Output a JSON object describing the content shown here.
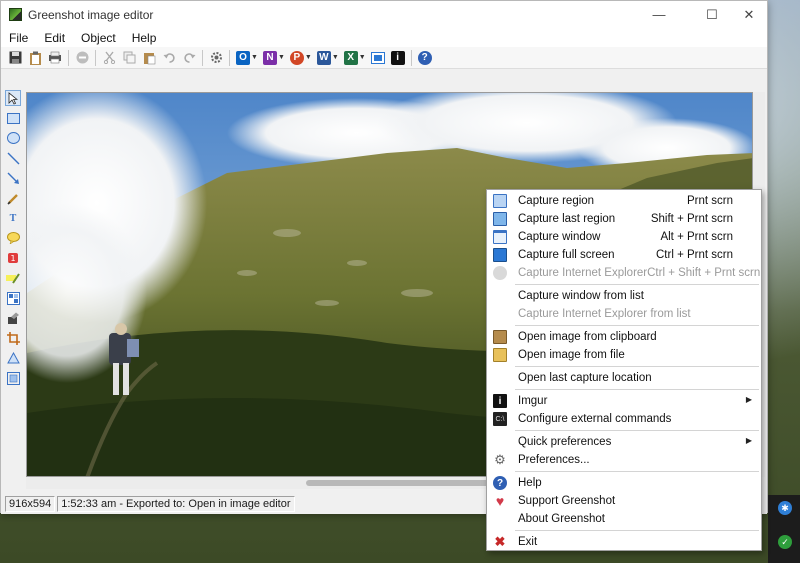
{
  "window": {
    "title": "Greenshot image editor",
    "minimize_glyph": "—",
    "maximize_glyph": "☐",
    "close_glyph": "✕"
  },
  "menubar": {
    "items": [
      {
        "label": "File"
      },
      {
        "label": "Edit"
      },
      {
        "label": "Object"
      },
      {
        "label": "Help"
      }
    ]
  },
  "toolbar": {
    "buttons": [
      "save-icon",
      "clipboard-icon",
      "print-icon",
      "delete-icon",
      "cut-icon",
      "copy-icon",
      "paste-icon",
      "undo-icon",
      "redo-icon",
      "settings-icon",
      "outlook-icon",
      "onenote-icon",
      "powerpoint-icon",
      "word-icon",
      "excel-icon",
      "resize-icon",
      "imgur-icon",
      "help-icon"
    ]
  },
  "tools": [
    "cursor-icon",
    "rectangle-icon",
    "ellipse-icon",
    "line-icon",
    "arrow-icon",
    "freehand-icon",
    "text-icon",
    "speechbubble-icon",
    "counter-icon",
    "highlight-icon",
    "obfuscate-icon",
    "effects-icon",
    "crop-icon",
    "rotate-icon",
    "zoom-icon"
  ],
  "statusbar": {
    "dimensions": "916x594",
    "message": "1:52:33 am - Exported to: Open in image editor"
  },
  "colors": {
    "accent": "#2b78d4",
    "menu_bg": "#ffffff",
    "disabled_text": "#9a9a9a"
  },
  "context_menu": {
    "groups": [
      {
        "items": [
          {
            "label": "Capture region",
            "shortcut": "Prnt scrn",
            "icon": "capture-region-icon",
            "disabled": false
          },
          {
            "label": "Capture last region",
            "shortcut": "Shift + Prnt scrn",
            "icon": "capture-last-region-icon",
            "disabled": false
          },
          {
            "label": "Capture window",
            "shortcut": "Alt + Prnt scrn",
            "icon": "capture-window-icon",
            "disabled": false
          },
          {
            "label": "Capture full screen",
            "shortcut": "Ctrl + Prnt scrn",
            "icon": "capture-fullscreen-icon",
            "disabled": false
          },
          {
            "label": "Capture Internet Explorer",
            "shortcut": "Ctrl + Shift + Prnt scrn",
            "icon": "internet-explorer-icon",
            "disabled": true
          }
        ]
      },
      {
        "items": [
          {
            "label": "Capture window from list",
            "shortcut": "",
            "icon": "",
            "disabled": false
          },
          {
            "label": "Capture Internet Explorer from list",
            "shortcut": "",
            "icon": "",
            "disabled": true
          }
        ]
      },
      {
        "items": [
          {
            "label": "Open image from clipboard",
            "shortcut": "",
            "icon": "clipboard-icon",
            "disabled": false
          },
          {
            "label": "Open image from file",
            "shortcut": "",
            "icon": "open-file-icon",
            "disabled": false
          }
        ]
      },
      {
        "items": [
          {
            "label": "Open last capture location",
            "shortcut": "",
            "icon": "",
            "disabled": false
          }
        ]
      },
      {
        "items": [
          {
            "label": "Imgur",
            "shortcut": "",
            "icon": "imgur-icon",
            "disabled": false,
            "submenu": true
          },
          {
            "label": "Configure external commands",
            "shortcut": "",
            "icon": "command-prompt-icon",
            "disabled": false
          }
        ]
      },
      {
        "items": [
          {
            "label": "Quick preferences",
            "shortcut": "",
            "icon": "",
            "disabled": false,
            "submenu": true
          },
          {
            "label": "Preferences...",
            "shortcut": "",
            "icon": "gear-icon",
            "disabled": false
          }
        ]
      },
      {
        "items": [
          {
            "label": "Help",
            "shortcut": "",
            "icon": "help-icon",
            "disabled": false
          },
          {
            "label": "Support Greenshot",
            "shortcut": "",
            "icon": "heart-icon",
            "disabled": false
          },
          {
            "label": "About Greenshot",
            "shortcut": "",
            "icon": "",
            "disabled": false
          }
        ]
      },
      {
        "items": [
          {
            "label": "Exit",
            "shortcut": "",
            "icon": "exit-icon",
            "disabled": false
          }
        ]
      }
    ]
  }
}
